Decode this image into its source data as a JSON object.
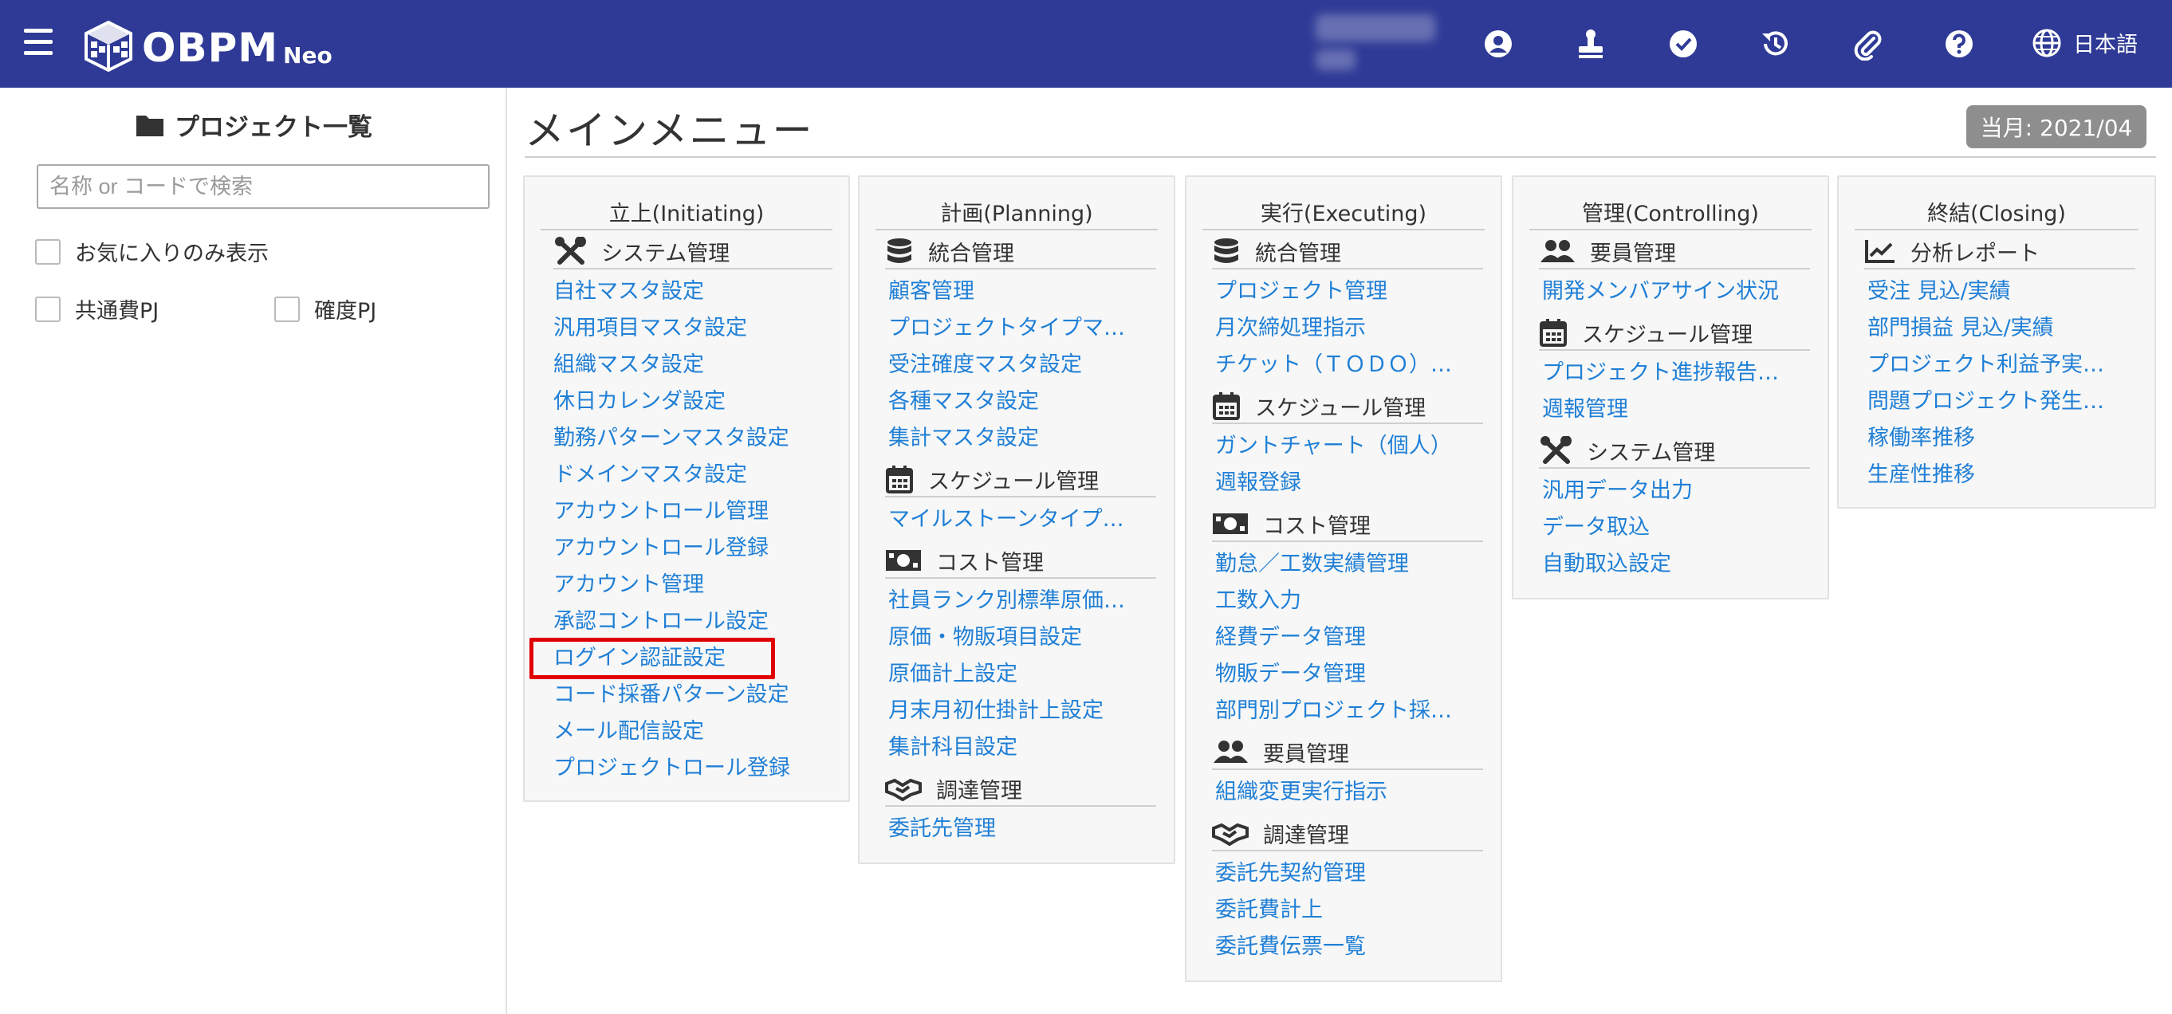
{
  "header": {
    "logo_text": "OBPM",
    "logo_sub": "Neo",
    "language_label": "日本語",
    "bg_color": "#2e3a96",
    "icons": [
      "user-circle-icon",
      "stamp-icon",
      "check-circle-icon",
      "history-icon",
      "paperclip-icon",
      "help-icon",
      "globe-icon"
    ]
  },
  "sidebar": {
    "title": "プロジェクト一覧",
    "search_placeholder": "名称 or コードで検索",
    "favorites_label": "お気に入りのみ表示",
    "common_cost_label": "共通費PJ",
    "certainty_label": "確度PJ"
  },
  "main": {
    "title": "メインメニュー",
    "month_badge": "当月: 2021/04"
  },
  "panels": {
    "initiating": {
      "title": "立上(Initiating)",
      "sec1": "システム管理",
      "links": [
        "自社マスタ設定",
        "汎用項目マスタ設定",
        "組織マスタ設定",
        "休日カレンダ設定",
        "勤務パターンマスタ設定",
        "ドメインマスタ設定",
        "アカウントロール管理",
        "アカウントロール登録",
        "アカウント管理",
        "承認コントロール設定",
        "ログイン認証設定",
        "コード採番パターン設定",
        "メール配信設定",
        "プロジェクトロール登録"
      ]
    },
    "planning": {
      "title": "計画(Planning)",
      "sec1": "統合管理",
      "links1": [
        "顧客管理",
        "プロジェクトタイプマ…",
        "受注確度マスタ設定",
        "各種マスタ設定",
        "集計マスタ設定"
      ],
      "sec2": "スケジュール管理",
      "links2": [
        "マイルストーンタイプ…"
      ],
      "sec3": "コスト管理",
      "links3": [
        "社員ランク別標準原価…",
        "原価・物販項目設定",
        "原価計上設定",
        "月末月初仕掛計上設定",
        "集計科目設定"
      ],
      "sec4": "調達管理",
      "links4": [
        "委託先管理"
      ]
    },
    "executing": {
      "title": "実行(Executing)",
      "sec1": "統合管理",
      "links1": [
        "プロジェクト管理",
        "月次締処理指示",
        "チケット（ＴＯＤＯ）…"
      ],
      "sec2": "スケジュール管理",
      "links2": [
        "ガントチャート（個人）",
        "週報登録"
      ],
      "sec3": "コスト管理",
      "links3": [
        "勤怠／工数実績管理",
        "工数入力",
        "経費データ管理",
        "物販データ管理",
        "部門別プロジェクト採…"
      ],
      "sec4": "要員管理",
      "links4": [
        "組織変更実行指示"
      ],
      "sec5": "調達管理",
      "links5": [
        "委託先契約管理",
        "委託費計上",
        "委託費伝票一覧"
      ]
    },
    "controlling": {
      "title": "管理(Controlling)",
      "sec1": "要員管理",
      "links1": [
        "開発メンバアサイン状況"
      ],
      "sec2": "スケジュール管理",
      "links2": [
        "プロジェクト進捗報告…",
        "週報管理"
      ],
      "sec3": "システム管理",
      "links3": [
        "汎用データ出力",
        "データ取込",
        "自動取込設定"
      ]
    },
    "closing": {
      "title": "終結(Closing)",
      "sec1": "分析レポート",
      "links1": [
        "受注 見込/実績",
        "部門損益 見込/実績",
        "プロジェクト利益予実…",
        "問題プロジェクト発生…",
        "稼働率推移",
        "生産性推移"
      ]
    }
  }
}
